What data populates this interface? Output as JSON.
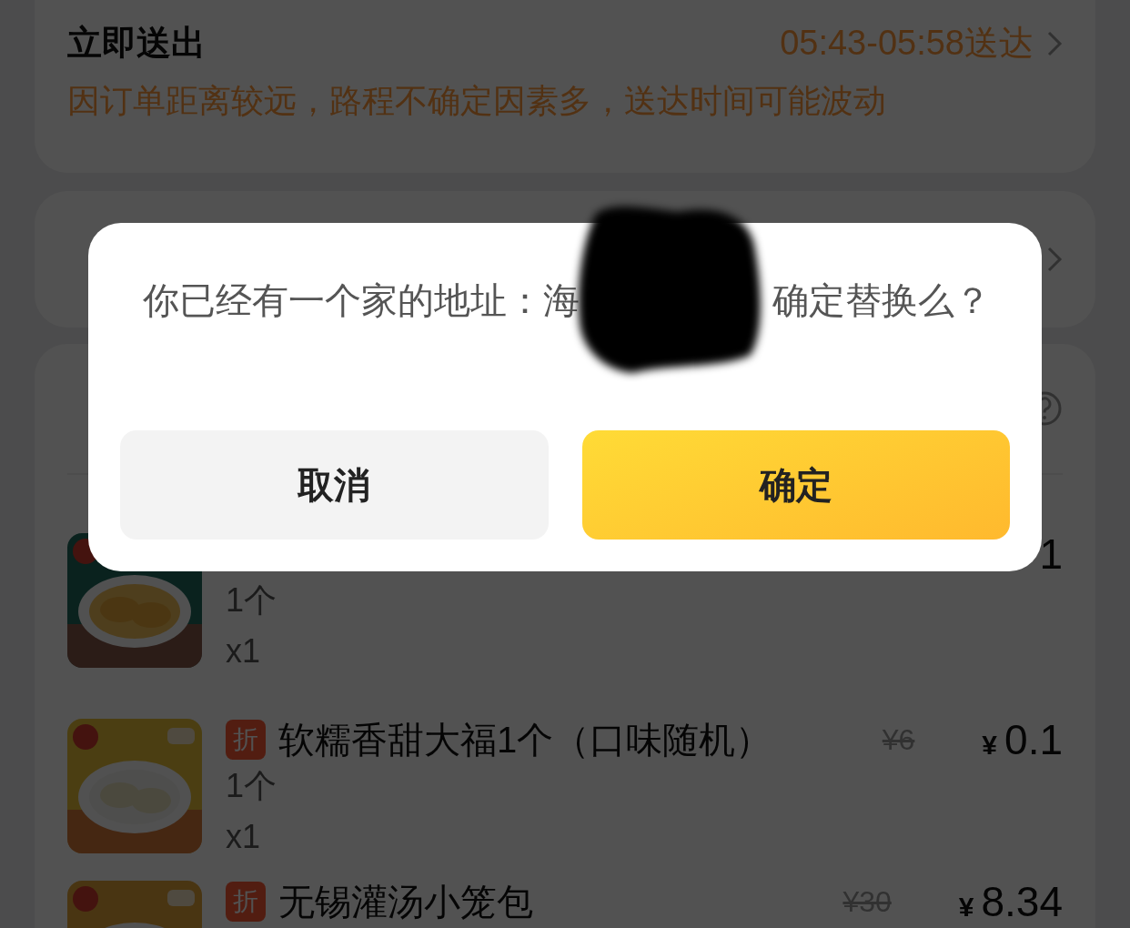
{
  "delivery": {
    "title": "立即送出",
    "time": "05:43-05:58送达",
    "note": "因订单距离较远，路程不确定因素多，送达时间可能波动"
  },
  "items": [
    {
      "spec": "1个",
      "qty": "x1",
      "amount": "1"
    },
    {
      "tag": "折",
      "name": "软糯香甜大福1个（口味随机）",
      "original_price": "¥6",
      "currency": "¥",
      "amount": "0.1",
      "spec": "1个",
      "qty": "x1"
    },
    {
      "tag": "折",
      "name": "无锡灌汤小笼包",
      "original_price": "¥30",
      "currency": "¥",
      "amount": "8.34"
    }
  ],
  "dialog": {
    "message": "你已经有一个家的地址：海",
    "message_end": "确定替换么？",
    "buttons": [
      {
        "label": "取消",
        "kind": "secondary"
      },
      {
        "label": "确定",
        "kind": "primary"
      }
    ]
  }
}
